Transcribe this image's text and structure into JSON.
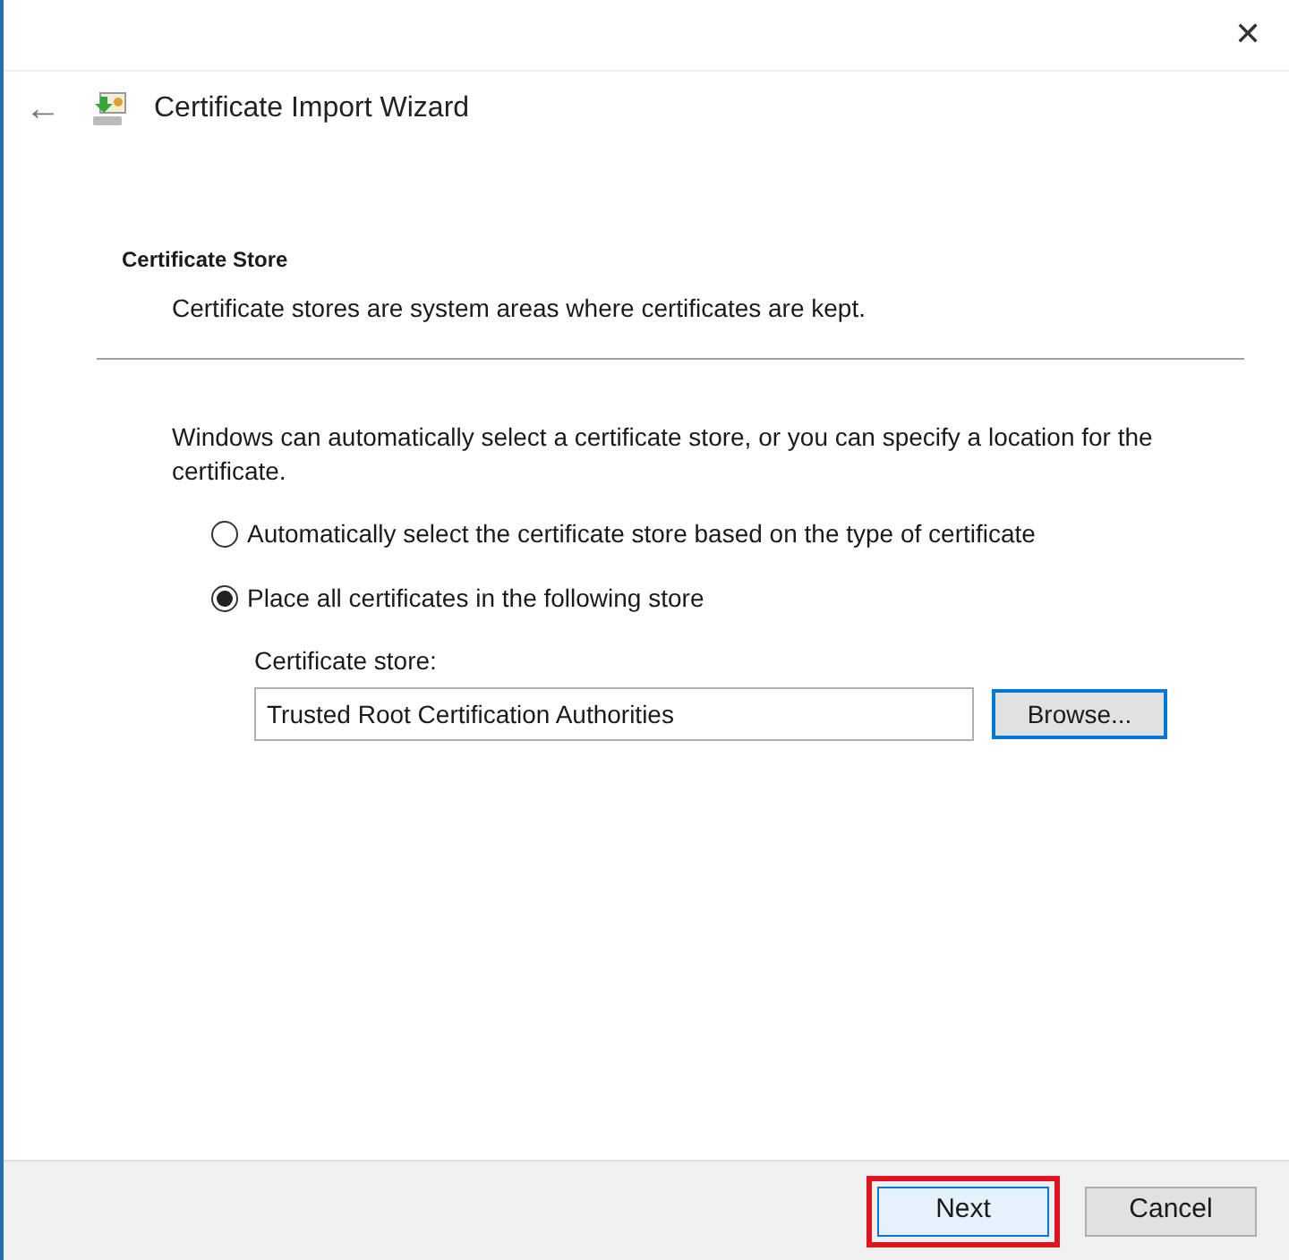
{
  "window": {
    "close": "✕"
  },
  "header": {
    "back": "←",
    "title": "Certificate Import Wizard"
  },
  "section": {
    "title": "Certificate Store",
    "subtitle": "Certificate stores are system areas where certificates are kept."
  },
  "intro": "Windows can automatically select a certificate store, or you can specify a location for the certificate.",
  "options": [
    {
      "label": "Automatically select the certificate store based on the type of certificate",
      "selected": false
    },
    {
      "label": "Place all certificates in the following store",
      "selected": true
    }
  ],
  "store": {
    "label": "Certificate store:",
    "value": "Trusted Root Certification Authorities",
    "browse": "Browse..."
  },
  "buttons": [
    {
      "label": "Next",
      "default": true,
      "highlighted": true
    },
    {
      "label": "Cancel",
      "default": false,
      "highlighted": false
    }
  ]
}
